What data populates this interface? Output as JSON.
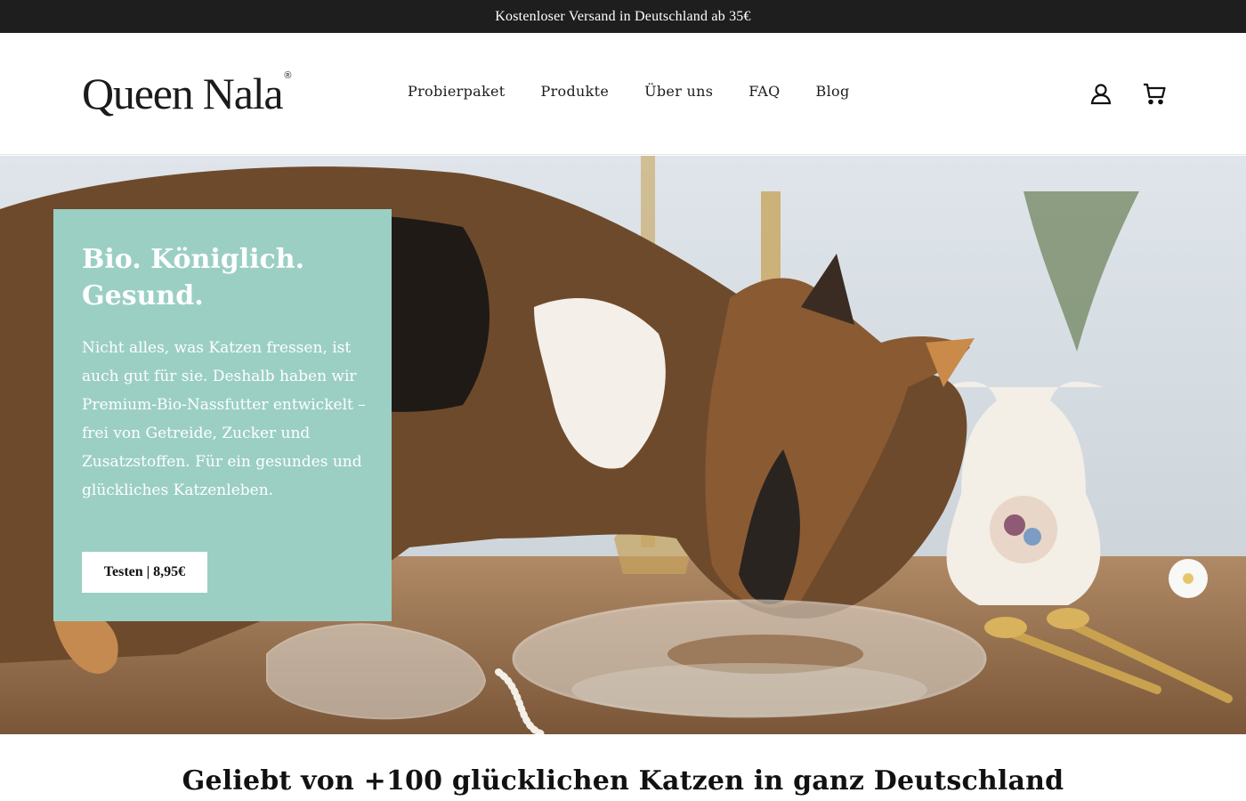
{
  "announcement": {
    "text": "Kostenloser Versand in Deutschland ab 35€"
  },
  "header": {
    "logo_text": "Queen Nala",
    "logo_mark": "®",
    "nav": [
      {
        "label": "Probierpaket"
      },
      {
        "label": "Produkte"
      },
      {
        "label": "Über uns"
      },
      {
        "label": "FAQ"
      },
      {
        "label": "Blog"
      }
    ],
    "icons": {
      "account": "account-icon",
      "cart": "cart-icon"
    }
  },
  "hero": {
    "title": "Bio. Königlich. Gesund.",
    "text": "Nicht alles, was Katzen fressen, ist auch gut für sie. Deshalb haben wir Premium-Bio-Nassfutter entwickelt – frei von Getreide, Zucker und Zusatzstoffen. Für ein gesundes und glückliches Katzenleben.",
    "cta_label": "Testen | 8,95€",
    "card_color": "#9bcfc4"
  },
  "section": {
    "title": "Geliebt von +100 glücklichen Katzen in ganz Deutschland"
  },
  "colors": {
    "announcement_bg": "#1e1e1e",
    "accent_teal": "#9bcfc4"
  }
}
